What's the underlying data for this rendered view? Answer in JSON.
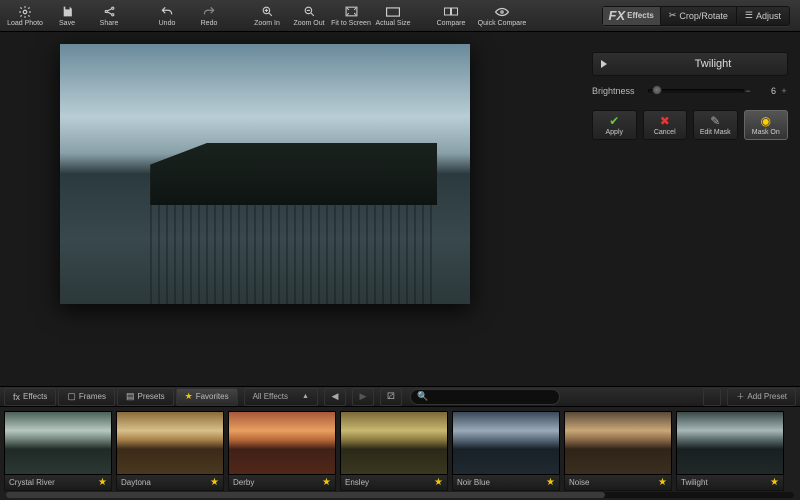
{
  "toolbar": {
    "load": "Load Photo",
    "save": "Save",
    "share": "Share",
    "undo": "Undo",
    "redo": "Redo",
    "zoomin": "Zoom In",
    "zoomout": "Zoom Out",
    "fit": "Fit to Screen",
    "actual": "Actual Size",
    "compare": "Compare",
    "quick": "Quick Compare",
    "fx": "FX",
    "effects": "Effects",
    "crop": "Crop/Rotate",
    "adjust": "Adjust"
  },
  "panel": {
    "title": "Twilight",
    "brightness_label": "Brightness",
    "brightness_value": "6",
    "apply": "Apply",
    "cancel": "Cancel",
    "editmask": "Edit Mask",
    "maskon": "Mask On"
  },
  "strip": {
    "tabs": {
      "effects": "Effects",
      "frames": "Frames",
      "presets": "Presets",
      "favorites": "Favorites"
    },
    "dropdown": "All Effects",
    "search_placeholder": "",
    "addpreset": "Add Preset"
  },
  "thumbs": [
    {
      "label": "Crystal River",
      "filter": "f-river"
    },
    {
      "label": "Daytona",
      "filter": "f-daytona"
    },
    {
      "label": "Derby",
      "filter": "f-derby"
    },
    {
      "label": "Ensley",
      "filter": "f-ensley"
    },
    {
      "label": "Noir Blue",
      "filter": "f-noir"
    },
    {
      "label": "Noise",
      "filter": "f-noise"
    },
    {
      "label": "Twilight",
      "filter": "f-twilight"
    }
  ]
}
